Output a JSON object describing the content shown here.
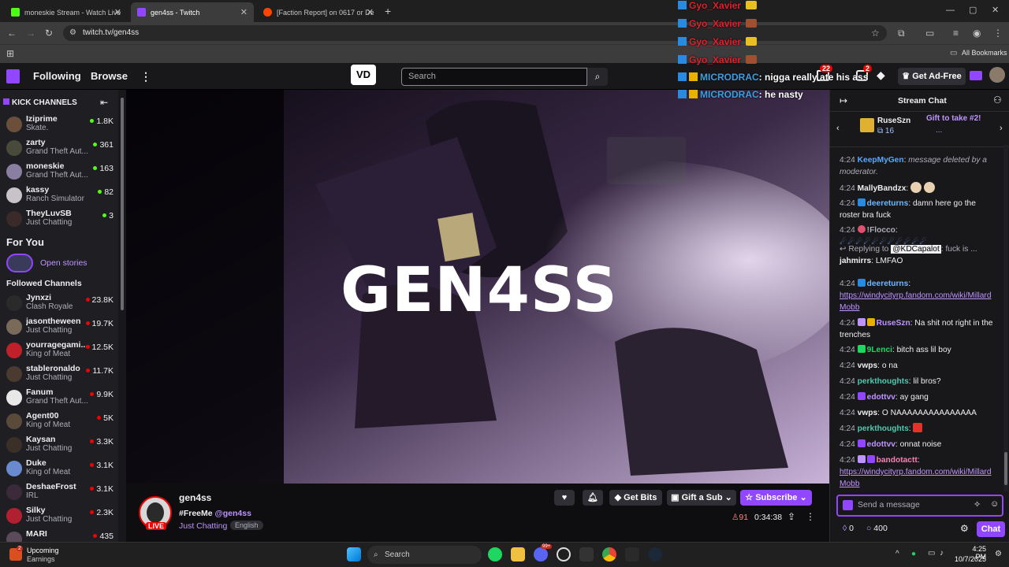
{
  "browser": {
    "tabs": [
      {
        "title": "moneskie Stream - Watch Live",
        "favicon_color": "#53fc18"
      },
      {
        "title": "gen4ss - Twitch",
        "favicon_color": "#9147ff"
      },
      {
        "title": "[Faction Report] on 0617 or De",
        "favicon_color": "#ff4500"
      }
    ],
    "url": "twitch.tv/gen4ss",
    "all_bookmarks": "All Bookmarks"
  },
  "twitch_nav": {
    "following": "Following",
    "browse": "Browse",
    "search_placeholder": "Search",
    "notif_count": "22",
    "whisper_count": "2",
    "get_ad_free": "Get Ad-Free"
  },
  "overlay_chat": [
    {
      "user": "Gyo_Xavier",
      "text": "",
      "color": "#e0212b"
    },
    {
      "user": "Gyo_Xavier",
      "text": "",
      "color": "#e0212b"
    },
    {
      "user": "Gyo_Xavier",
      "text": "",
      "color": "#e0212b"
    },
    {
      "user": "Gyo_Xavier",
      "text": "",
      "color": "#e0212b"
    },
    {
      "user": "MICRODRAC",
      "text": ": nigga really ate his ass",
      "color": "#3f9fe0"
    },
    {
      "user": "MICRODRAC",
      "text": ": he nasty",
      "color": "#3f9fe0"
    }
  ],
  "sidebar": {
    "kick_header": "KICK CHANNELS",
    "kick_channels": [
      {
        "name": "Iziprime",
        "game": "Skate.",
        "viewers": "1.8K",
        "avatar": "#6b4f3a"
      },
      {
        "name": "zarty",
        "game": "Grand Theft Aut...",
        "viewers": "361",
        "avatar": "#4a4a3a"
      },
      {
        "name": "moneskie",
        "game": "Grand Theft Aut...",
        "viewers": "163",
        "avatar": "#8a7fa0"
      },
      {
        "name": "kassy",
        "game": "Ranch Simulator",
        "viewers": "82",
        "avatar": "#c9c2c8"
      },
      {
        "name": "TheyLuvSB",
        "game": "Just Chatting",
        "viewers": "3",
        "avatar": "#3a2a2a"
      }
    ],
    "for_you": "For You",
    "open_stories": "Open stories",
    "followed_header": "Followed Channels",
    "followed": [
      {
        "name": "Jynxzi",
        "game": "Clash Royale",
        "viewers": "23.8K",
        "avatar": "#2a2a2a"
      },
      {
        "name": "jasontheween",
        "game": "Just Chatting",
        "viewers": "19.7K",
        "avatar": "#7a6a5a"
      },
      {
        "name": "yourragegami...",
        "game": "King of Meat",
        "viewers": "12.5K",
        "avatar": "#c0202a"
      },
      {
        "name": "stableronaldo",
        "game": "Just Chatting",
        "viewers": "11.7K",
        "avatar": "#4a3a30"
      },
      {
        "name": "Fanum",
        "game": "Grand Theft Aut...",
        "viewers": "9.9K",
        "avatar": "#e8e8e8"
      },
      {
        "name": "Agent00",
        "game": "King of Meat",
        "viewers": "5K",
        "avatar": "#5a4a3a"
      },
      {
        "name": "Kaysan",
        "game": "Just Chatting",
        "viewers": "3.3K",
        "avatar": "#3a3028"
      },
      {
        "name": "Duke",
        "game": "King of Meat",
        "viewers": "3.1K",
        "avatar": "#6a8ad0"
      },
      {
        "name": "DeshaeFrost",
        "game": "IRL",
        "viewers": "3.1K",
        "avatar": "#3a2a3a"
      },
      {
        "name": "Silky",
        "game": "Just Chatting",
        "viewers": "2.3K",
        "avatar": "#b02030"
      },
      {
        "name": "MARI",
        "game": "",
        "viewers": "435",
        "avatar": "#5a4a5a"
      }
    ]
  },
  "player": {
    "title_overlay": "GEN4SS"
  },
  "stream_info": {
    "channel": "gen4ss",
    "live": "LIVE",
    "title": "#FreeMe ",
    "mention": "@gen4ss",
    "category": "Just Chatting",
    "tag": "English",
    "viewers": "91",
    "uptime": "0:34:38",
    "get_bits": "Get Bits",
    "gift_sub": "Gift a Sub",
    "subscribe": "Subscribe"
  },
  "chat": {
    "header": "Stream Chat",
    "gift_user": "RuseSzn",
    "gift_count": "16",
    "gift_msg": "Gift to take #2!",
    "gift_msg2": "...",
    "messages": [
      {
        "time": "4:24",
        "user": "KeepMyGen",
        "color": "#5ba8ff",
        "text": "message deleted by a moderator.",
        "italic": true
      },
      {
        "time": "4:24",
        "user": "MallyBandzx",
        "color": "#efeff1",
        "text": ""
      },
      {
        "time": "4:24",
        "user": "deereturns",
        "color": "#6fb6ff",
        "text": "damn here go the roster bra fuck"
      },
      {
        "time": "4:24",
        "user": "!Flocco",
        "color": "#adadb8",
        "text": ""
      },
      {
        "time": "",
        "user": "jahmirrs",
        "color": "#efeff1",
        "text": "LMFAO",
        "reply_to": "@KDCapalot",
        "reply_text": ": fuck",
        "reply_label": "Replying to",
        "reply_tail": "is ..."
      },
      {
        "time": "4:24",
        "user": "deereturns",
        "color": "#6fb6ff",
        "text": "https://windycityrp.fandom.com/wiki/Millard Mobb",
        "link": true
      },
      {
        "time": "4:24",
        "user": "RuseSzn",
        "color": "#bf94ff",
        "text": "Na shit not right in the trenches"
      },
      {
        "time": "4:24",
        "user": "9Lenci",
        "color": "#1ed760",
        "text": "bitch ass lil boy"
      },
      {
        "time": "4:24",
        "user": "vwps",
        "color": "#efeff1",
        "text": "o na"
      },
      {
        "time": "4:24",
        "user": "perkthoughts",
        "color": "#4fc9b0",
        "text": "lil bros?"
      },
      {
        "time": "4:24",
        "user": "edottvv",
        "color": "#bf94ff",
        "text": "ay gang"
      },
      {
        "time": "4:24",
        "user": "vwps",
        "color": "#efeff1",
        "text": "O NAAAAAAAAAAAAAAA"
      },
      {
        "time": "4:24",
        "user": "perkthoughts",
        "color": "#4fc9b0",
        "text": ""
      },
      {
        "time": "4:24",
        "user": "edottvv",
        "color": "#bf94ff",
        "text": "onnat noise"
      },
      {
        "time": "4:24",
        "user": "bandotactt",
        "color": "#ff7eb6",
        "text": "https://windycityrp.fandom.com/wiki/Millard Mobb",
        "link": true
      }
    ],
    "input_placeholder": "Send a message",
    "points": "0",
    "bits": "400",
    "chat_button": "Chat"
  },
  "taskbar": {
    "weather_title": "Upcoming",
    "weather_sub": "Earnings",
    "weather_badge": "2",
    "search": "Search",
    "discord_badge": "99+",
    "time": "4:25 PM",
    "date": "10/7/2025"
  }
}
